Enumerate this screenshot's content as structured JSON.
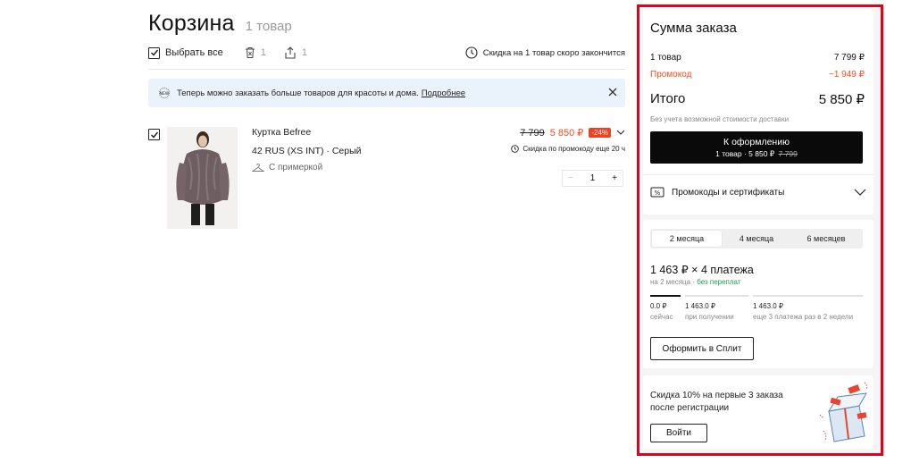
{
  "cart": {
    "title": "Корзина",
    "count": "1 товар",
    "select_all": "Выбрать все",
    "delete_count": "1",
    "share_count": "1",
    "discount_timer": "Скидка на 1 товар скоро закончится"
  },
  "notice": {
    "text": "Теперь можно заказать больше товаров для красоты и дома.",
    "link": "Подробнее"
  },
  "item": {
    "name": "Куртка Befree",
    "size_color": "42 RUS (XS INT) · Серый",
    "fitting": "С примеркой",
    "old_price": "7 799",
    "new_price": "5 850 ₽",
    "discount": "-24%",
    "promo_note": "Скидка по промокоду еще 20 ч",
    "quantity": "1",
    "minus": "−",
    "plus": "+"
  },
  "summary": {
    "title": "Сумма заказа",
    "items_label": "1 товар",
    "items_value": "7 799 ₽",
    "promo_label": "Промокод",
    "promo_value": "−1 949 ₽",
    "total_label": "Итого",
    "total_value": "5 850 ₽",
    "delivery_note": "Без учета возможной стоимости доставки",
    "checkout_label": "К оформлению",
    "checkout_sub": "1 товар · 5 850 ₽",
    "checkout_old": "7 799",
    "promocodes": "Промокоды и сертификаты"
  },
  "split": {
    "tabs": [
      "2 месяца",
      "4 месяца",
      "6 месяцев"
    ],
    "amount": "1 463 ₽ × 4 платежа",
    "period": "на 2 месяца ·",
    "no_overpay": "без переплат",
    "payments": [
      {
        "amount": "0.0 ₽",
        "label": "сейчас"
      },
      {
        "amount": "1 463.0 ₽",
        "label": "при получении"
      },
      {
        "amount": "1 463.0 ₽",
        "label": "еще 3 платежа раз в 2 недели"
      }
    ],
    "button": "Оформить в Сплит"
  },
  "register": {
    "text": "Скидка 10% на первые 3 заказа после регистрации",
    "button": "Войти"
  },
  "colors": {
    "accent": "#ff4a1c",
    "highlight_border": "#e3001b",
    "green": "#1aa64a"
  }
}
